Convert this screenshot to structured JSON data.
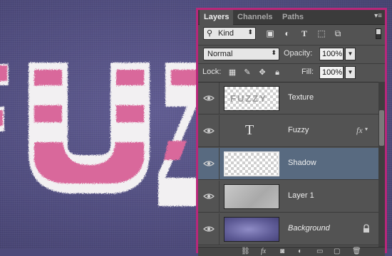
{
  "colors": {
    "panel_border": "#b8277a",
    "selected_row": "#586a80",
    "fur_pink": "#d9679b",
    "fur_white": "#f2f2f2",
    "canvas": "#514e80"
  },
  "tabs": [
    {
      "label": "Layers",
      "active": true
    },
    {
      "label": "Channels",
      "active": false
    },
    {
      "label": "Paths",
      "active": false
    }
  ],
  "panel_menu_icon": "panel-menu-icon",
  "filter": {
    "kind_label": "Kind",
    "kind_icon": "search-icon",
    "icons": [
      "image-filter-icon",
      "adjustment-filter-icon",
      "type-filter-icon",
      "shape-filter-icon",
      "smart-object-filter-icon"
    ]
  },
  "blend": {
    "mode": "Normal",
    "opacity_label": "Opacity:",
    "opacity_value": "100%"
  },
  "lock": {
    "label": "Lock:",
    "icons": [
      "lock-transparent-icon",
      "lock-image-icon",
      "lock-position-icon",
      "lock-all-icon"
    ],
    "fill_label": "Fill:",
    "fill_value": "100%"
  },
  "layers": [
    {
      "name": "Texture",
      "thumb": "fuzzy-text-thumb",
      "thumb_text": "FUZZY",
      "visible": true,
      "selected": false
    },
    {
      "name": "Fuzzy",
      "thumb": "type-layer",
      "type_glyph": "T",
      "fx": "fx",
      "visible": true,
      "selected": false
    },
    {
      "name": "Shadow",
      "thumb": "transparent",
      "visible": true,
      "selected": true
    },
    {
      "name": "Layer 1",
      "thumb": "gray",
      "visible": true,
      "selected": false
    },
    {
      "name": "Background",
      "thumb": "purple",
      "visible": true,
      "selected": false,
      "locked": true,
      "italic": true
    }
  ],
  "bottom_icons": [
    "link-layers-icon",
    "fx-icon",
    "mask-icon",
    "adjustment-icon",
    "group-icon",
    "new-layer-icon",
    "trash-icon"
  ],
  "bottom_fx_label": "fx"
}
